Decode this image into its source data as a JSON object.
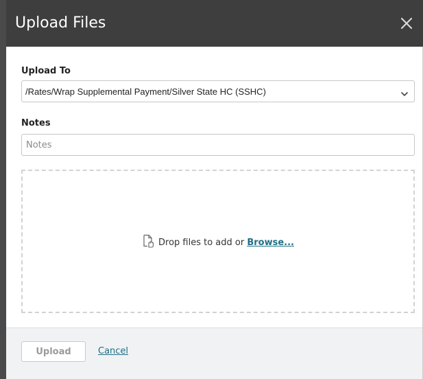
{
  "dialog": {
    "title": "Upload Files"
  },
  "upload_to": {
    "label": "Upload To",
    "selected_value": "/Rates/Wrap Supplemental Payment/Silver State HC (SSHC)"
  },
  "notes": {
    "label": "Notes",
    "placeholder": "Notes",
    "value": ""
  },
  "dropzone": {
    "prefix_text": "Drop files to add or ",
    "browse_label": "Browse..."
  },
  "footer": {
    "upload_label": "Upload",
    "cancel_label": "Cancel"
  },
  "icons": {
    "close": "close-icon",
    "chevron": "chevron-down-icon",
    "file": "file-upload-icon"
  },
  "colors": {
    "header_bg": "#3e3e3e",
    "link": "#1f6f86",
    "footer_bg": "#f1f2f3"
  }
}
